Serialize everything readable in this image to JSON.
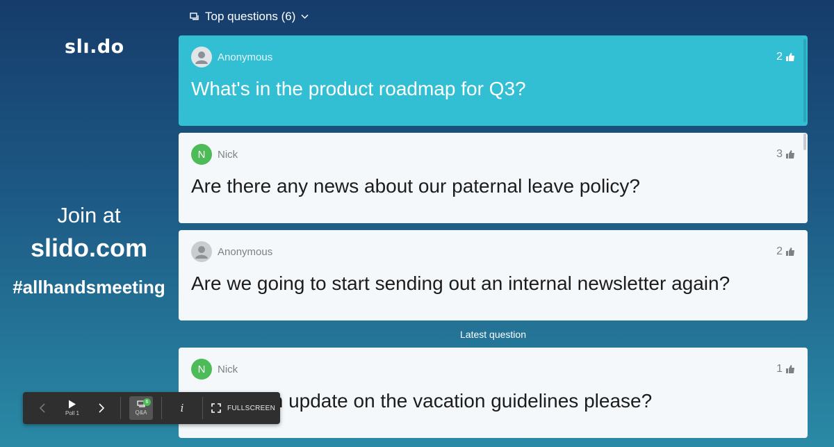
{
  "brand": {
    "logo_text": "slı.do"
  },
  "join": {
    "line1": "Join at",
    "line2": "slido.com",
    "line3": "#allhandsmeeting"
  },
  "header": {
    "label": "Top questions (6)"
  },
  "questions": [
    {
      "author": "Anonymous",
      "avatar": "person-icon",
      "text": "What's in the product roadmap for Q3?",
      "votes": "2"
    },
    {
      "author": "Nick",
      "avatar_letter": "N",
      "text": "Are there any news about our paternal leave policy?",
      "votes": "3"
    },
    {
      "author": "Anonymous",
      "avatar": "person-icon",
      "text": "Are we going to start sending out an internal newsletter again?",
      "votes": "2"
    }
  ],
  "latest": {
    "label": "Latest question",
    "author": "Nick",
    "avatar_letter": "N",
    "text": "Is there an update on the vacation guidelines please?",
    "votes": "1"
  },
  "toolbar": {
    "poll_label": "Poll 1",
    "qa_label": "Q&A",
    "qa_badge": "6",
    "info_label": "i",
    "fullscreen_label": "FULLSCREEN"
  },
  "colors": {
    "highlight": "#32bfd3",
    "card": "#f4f8fa",
    "avatar_green": "#4dbb57"
  }
}
